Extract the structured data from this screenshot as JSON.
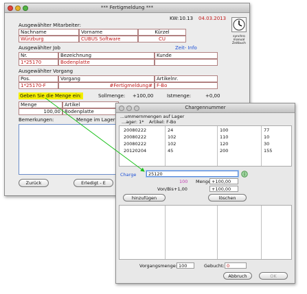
{
  "main_window": {
    "title": "*** Fertigmeldung ***",
    "kw_label": "KW:",
    "kw_value": "10.13",
    "date": "04.03.2013",
    "sections": {
      "mitarbeiter_label": "Ausgewählter Mitarbeiter:",
      "job_label": "Ausgewählter Job",
      "vorgang_label": "Ausgewählter Vorgang"
    },
    "mitarbeiter_headers": [
      "Nachname",
      "Vorname",
      "Kürzel"
    ],
    "mitarbeiter_values": [
      "Würzburg",
      "CUBUS Software",
      "CU"
    ],
    "zeit_info_link": "Zeit- Info",
    "job_headers": [
      "Nr.",
      "Bezeichnung",
      "Kunde"
    ],
    "job_values": [
      "1*25170",
      "Bodenplatte",
      ""
    ],
    "vorgang_headers": [
      "Pos.",
      "Vorgang",
      "Artikelnr."
    ],
    "vorgang_values": [
      "1*25170-F",
      "#Fertigmeldung#",
      "F-Bo"
    ],
    "prompt": "Geben Sie die Menge ein:",
    "sollmenge_label": "Sollmenge:",
    "sollmenge_value": "+100,00",
    "istmenge_label": "Istmenge:",
    "istmenge_value": "+0,00",
    "menge_header": "Menge",
    "artikel_header": "Artikel",
    "menge_value": "100,00",
    "artikel_value": "Bodenplatte",
    "bemerkungen_label": "Bemerkungen:",
    "menge_im_lager_label": "Menge im Lager",
    "zurueck_button": "Zurück",
    "erledigt_button": "Erledigt - E",
    "side_icon_caption": "synchro manual Zeitbuch"
  },
  "dialog": {
    "title": "Chargennummer",
    "subtitle": "...ummernmengen auf Lager",
    "top_headers": [
      "...ager: 1*",
      "Artikel: F-Bo"
    ],
    "top_rows": [
      [
        "20080222",
        "24",
        "100",
        "77"
      ],
      [
        "20080222",
        "102",
        "110",
        "10"
      ],
      [
        "20080222",
        "102",
        "120",
        "30"
      ],
      [
        "20120204",
        "45",
        "200",
        "155"
      ]
    ],
    "charge_label": "Charge",
    "charge_value": "25120",
    "charge_number_right": "100",
    "menge_label": "Menge",
    "menge_value": "+100,00",
    "von_bis_label": "Von/Bis",
    "von_value": "+1,00",
    "bis_value": "+100,00",
    "hinzufuegen_button": "hinzufügen",
    "loeschen_button": "löschen",
    "vorgangsmenge_label": "Vorgangsmenge:",
    "vorgangsmenge_value": "100",
    "gebucht_label": "Gebucht:",
    "gebucht_value": "0",
    "abbruch_button": "Abbruch",
    "ok_button": "OK"
  },
  "colors": {
    "accent_red": "#c01818",
    "highlight_yellow": "#f5f000",
    "arrow_green": "#19c019",
    "link_blue": "#1b4fd6"
  }
}
